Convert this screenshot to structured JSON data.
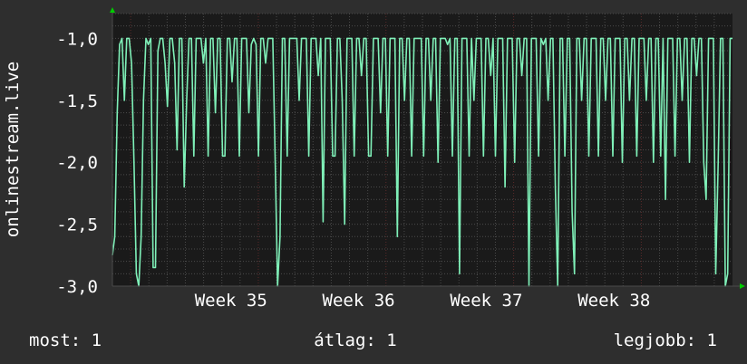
{
  "chart_data": {
    "type": "line",
    "ylabel": "onlinestream.live",
    "ylim": [
      -3.0,
      -0.8
    ],
    "y_ticks": [
      {
        "value": -1.0,
        "label": "-1,0"
      },
      {
        "value": -1.5,
        "label": "-1,5"
      },
      {
        "value": -2.0,
        "label": "-2,0"
      },
      {
        "value": -2.5,
        "label": "-2,5"
      },
      {
        "value": -3.0,
        "label": "-3,0"
      }
    ],
    "x_range_days": [
      0,
      34
    ],
    "x_ticks": [
      {
        "day": 5,
        "label": "Week 35"
      },
      {
        "day": 12,
        "label": "Week 36"
      },
      {
        "day": 19,
        "label": "Week 37"
      },
      {
        "day": 26,
        "label": "Week 38"
      }
    ],
    "grid": true,
    "colors": {
      "background": "#2e2e2e",
      "plot_background": "#1a1a1a",
      "line": "#7ff0b8",
      "grid": "#4a4a4a",
      "week_grid": "#5a2a2a",
      "axis_arrow": "#00cc00"
    },
    "series": [
      {
        "values": [
          -2.75,
          -2.6,
          -1.6,
          -1.05,
          -1.0,
          -1.5,
          -1.0,
          -1.0,
          -1.2,
          -2.0,
          -2.9,
          -3.0,
          -2.6,
          -1.5,
          -1.0,
          -1.05,
          -1.0,
          -2.85,
          -2.85,
          -1.1,
          -1.0,
          -1.0,
          -1.2,
          -1.55,
          -1.0,
          -1.0,
          -1.2,
          -1.9,
          -1.0,
          -1.0,
          -2.2,
          -1.5,
          -1.0,
          -1.0,
          -1.95,
          -1.0,
          -1.0,
          -1.0,
          -1.2,
          -1.0,
          -1.95,
          -1.0,
          -1.0,
          -1.6,
          -1.0,
          -1.0,
          -1.95,
          -1.95,
          -1.0,
          -1.0,
          -1.35,
          -1.0,
          -1.0,
          -1.95,
          -1.0,
          -1.0,
          -1.0,
          -1.6,
          -1.05,
          -1.0,
          -1.05,
          -1.95,
          -1.0,
          -1.0,
          -1.2,
          -1.0,
          -1.0,
          -1.0,
          -2.0,
          -3.0,
          -2.6,
          -1.0,
          -1.0,
          -1.95,
          -1.0,
          -1.0,
          -1.0,
          -1.0,
          -1.5,
          -1.0,
          -1.0,
          -1.0,
          -1.95,
          -1.0,
          -1.0,
          -1.0,
          -1.3,
          -1.0,
          -2.48,
          -1.0,
          -1.0,
          -1.0,
          -1.95,
          -1.95,
          -1.0,
          -1.0,
          -1.5,
          -2.5,
          -1.0,
          -1.0,
          -1.0,
          -1.95,
          -1.0,
          -1.0,
          -1.3,
          -1.0,
          -1.0,
          -1.95,
          -1.95,
          -1.0,
          -1.0,
          -1.0,
          -1.6,
          -1.0,
          -1.0,
          -1.95,
          -1.0,
          -1.0,
          -1.0,
          -2.6,
          -1.0,
          -1.0,
          -1.5,
          -1.0,
          -1.0,
          -1.95,
          -1.0,
          -1.0,
          -1.0,
          -1.0,
          -1.95,
          -1.0,
          -1.0,
          -1.5,
          -1.0,
          -1.0,
          -2.0,
          -1.0,
          -1.0,
          -1.0,
          -1.05,
          -1.0,
          -1.95,
          -1.0,
          -1.0,
          -2.9,
          -1.0,
          -1.0,
          -1.0,
          -1.95,
          -1.0,
          -1.5,
          -1.0,
          -1.0,
          -1.0,
          -1.95,
          -1.0,
          -1.0,
          -1.3,
          -1.0,
          -1.95,
          -1.0,
          -1.0,
          -1.0,
          -2.2,
          -1.0,
          -1.0,
          -1.0,
          -2.0,
          -1.0,
          -1.0,
          -1.3,
          -1.0,
          -1.0,
          -3.0,
          -1.0,
          -1.0,
          -1.0,
          -1.95,
          -1.0,
          -1.05,
          -1.0,
          -1.5,
          -1.0,
          -1.0,
          -2.2,
          -3.0,
          -1.0,
          -1.0,
          -1.95,
          -1.0,
          -1.0,
          -2.4,
          -2.9,
          -1.0,
          -1.0,
          -1.5,
          -1.0,
          -1.0,
          -1.95,
          -1.0,
          -1.0,
          -1.0,
          -1.95,
          -1.0,
          -1.0,
          -1.5,
          -1.0,
          -1.0,
          -1.95,
          -1.0,
          -1.0,
          -1.0,
          -2.0,
          -1.0,
          -1.0,
          -1.5,
          -1.0,
          -1.0,
          -1.95,
          -1.0,
          -1.0,
          -1.0,
          -1.5,
          -1.0,
          -1.0,
          -2.0,
          -1.0,
          -1.0,
          -1.95,
          -1.0,
          -2.3,
          -1.0,
          -1.0,
          -1.0,
          -1.95,
          -1.0,
          -1.0,
          -1.5,
          -1.0,
          -1.0,
          -2.0,
          -1.0,
          -1.0,
          -1.3,
          -1.0,
          -1.0,
          -2.0,
          -2.3,
          -1.0,
          -1.0,
          -1.0,
          -2.9,
          -2.0,
          -1.0,
          -1.0,
          -3.0,
          -2.9,
          -1.0,
          -1.0
        ]
      }
    ]
  },
  "footer": {
    "current": "most: 1",
    "average": "átlag: 1",
    "best": "legjobb: 1"
  }
}
